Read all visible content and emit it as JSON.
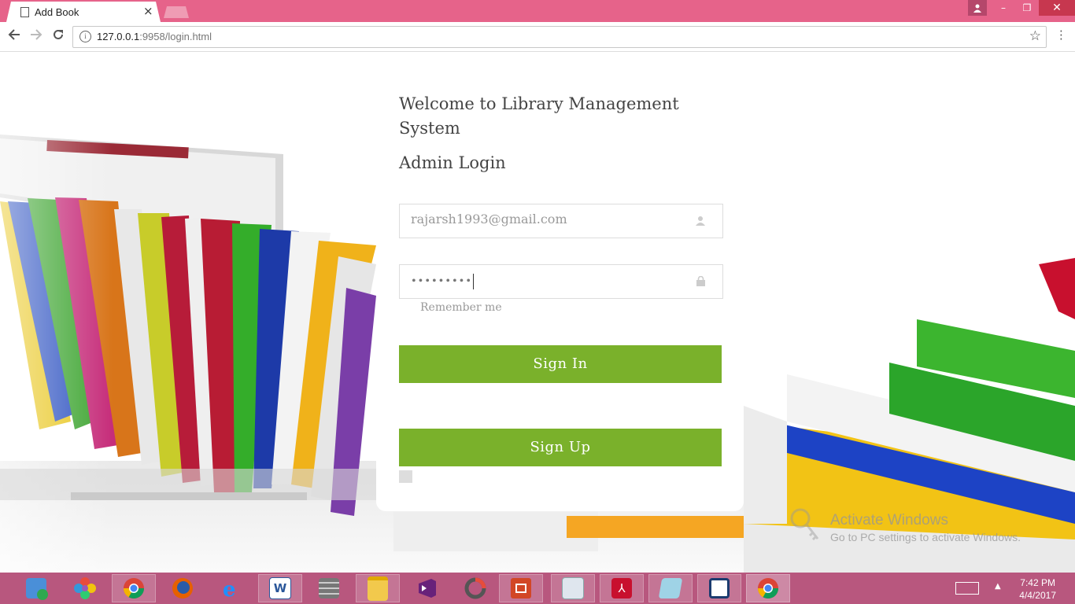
{
  "browser": {
    "tab_title": "Add Book",
    "tab_close": "×",
    "url_host": "127.0.0.1",
    "url_rest": ":9958/login.html",
    "window_controls": {
      "minimize": "–",
      "restore": "❐",
      "close": "✕"
    }
  },
  "login": {
    "welcome": "Welcome to Library Management System",
    "admin_title": "Admin Login",
    "email_value": "rajarsh1993@gmail.com",
    "password_value": "•••••••••",
    "remember_label": "Remember me",
    "signin_label": "Sign In",
    "signup_label": "Sign Up"
  },
  "watermark": {
    "line1": "Activate Windows",
    "line2": "Go to PC settings to activate Windows."
  },
  "taskbar": {
    "apps": [
      "media-player-icon",
      "photos-icon",
      "chrome-icon",
      "firefox-icon",
      "internet-explorer-icon",
      "word-icon",
      "firewall-icon",
      "file-explorer-icon",
      "visual-studio-icon",
      "recorder-icon",
      "powerpoint-icon",
      "calculator-icon",
      "acrobat-icon",
      "notepad-icon",
      "app-icon",
      "chrome-active-icon"
    ],
    "clock_time": "7:42 PM",
    "clock_date": "4/4/2017"
  },
  "colors": {
    "titlebar": "#e6638a",
    "accent_button": "#7ab12b",
    "taskbar": "#b8577e"
  }
}
